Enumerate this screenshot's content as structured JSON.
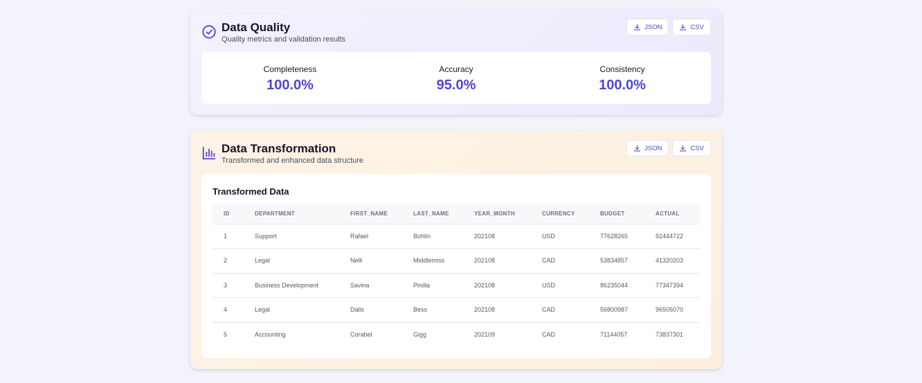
{
  "quality": {
    "title": "Data Quality",
    "subtitle": "Quality metrics and validation results",
    "json_label": "JSON",
    "csv_label": "CSV",
    "metrics": [
      {
        "label": "Completeness",
        "value": "100.0%"
      },
      {
        "label": "Accuracy",
        "value": "95.0%"
      },
      {
        "label": "Consistency",
        "value": "100.0%"
      }
    ],
    "icon": "check-circle-icon"
  },
  "transform": {
    "title": "Data Transformation",
    "subtitle": "Transformed and enhanced data structure",
    "json_label": "JSON",
    "csv_label": "CSV",
    "icon": "bar-chart-icon",
    "table_title": "Transformed Data",
    "columns": [
      "ID",
      "DEPARTMENT",
      "FIRST_NAME",
      "LAST_NAME",
      "YEAR_MONTH",
      "CURRENCY",
      "BUDGET",
      "ACTUAL"
    ],
    "rows": [
      [
        "1",
        "Support",
        "Rafael",
        "Bohlin",
        "202108",
        "USD",
        "77628265",
        "92444722"
      ],
      [
        "2",
        "Legal",
        "Nelli",
        "Middlemiss",
        "202108",
        "CAD",
        "53834857",
        "41320203"
      ],
      [
        "3",
        "Business Development",
        "Savina",
        "Pinilla",
        "202108",
        "USD",
        "86235044",
        "77347394"
      ],
      [
        "4",
        "Legal",
        "Dalis",
        "Bess",
        "202108",
        "CAD",
        "56800987",
        "96505070"
      ],
      [
        "5",
        "Accounting",
        "Corabel",
        "Gigg",
        "202109",
        "CAD",
        "71144057",
        "73837301"
      ]
    ]
  },
  "colors": {
    "accent": "#4f46d6",
    "background": "#f3f3fb",
    "quality_card": "#efedfc",
    "transform_card": "#fdf1e2"
  }
}
